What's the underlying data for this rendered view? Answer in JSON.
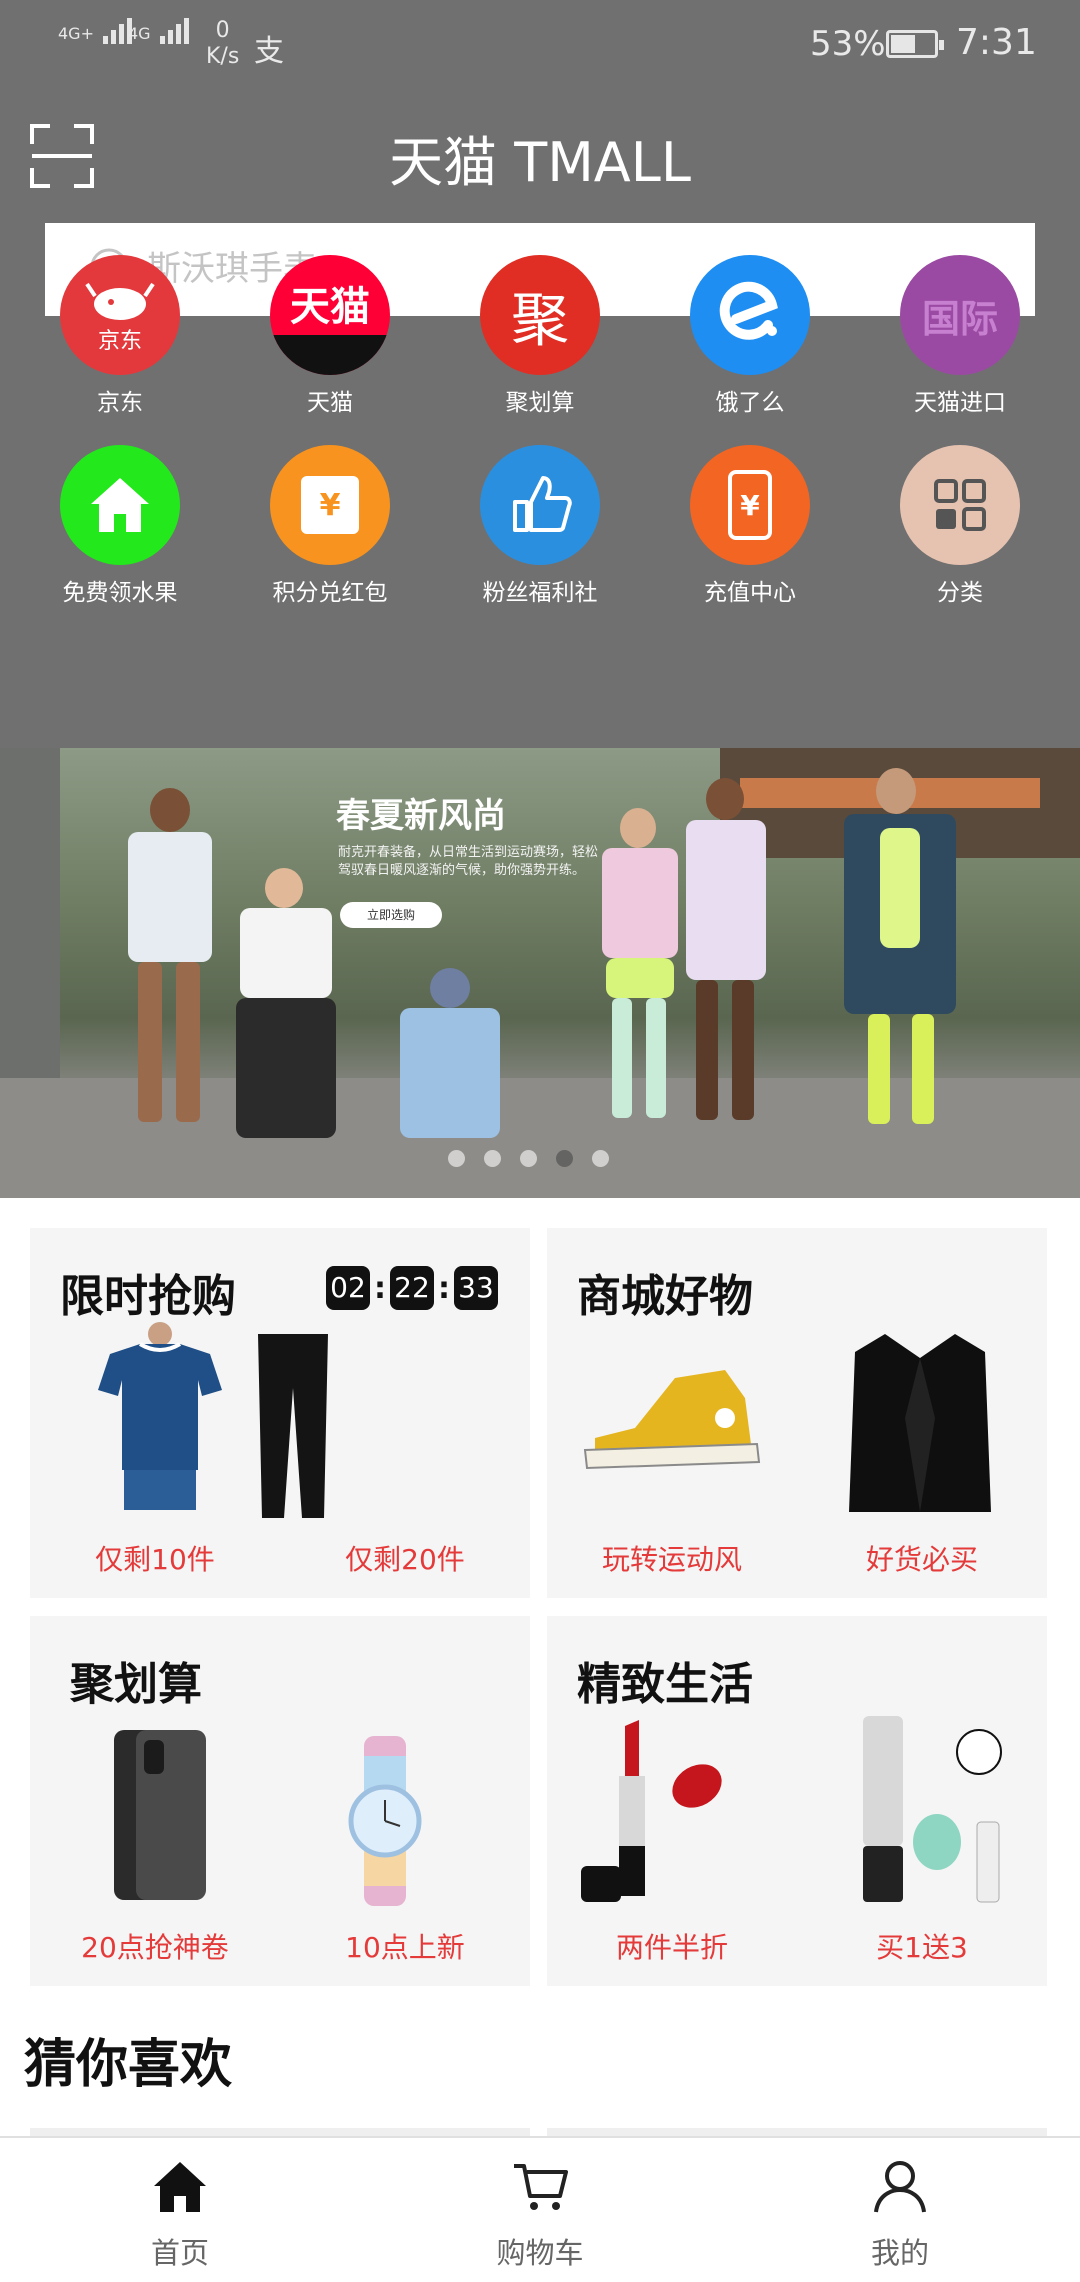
{
  "status_bar": {
    "sig1_label": "4G+",
    "sig2_label": "4G",
    "net_speed_value": "0",
    "net_speed_unit": "K/s",
    "alipay_glyph": "支",
    "battery_percent": "53%",
    "battery_level": 0.53,
    "time": "7:31"
  },
  "header": {
    "title": "天猫 TMALL",
    "scan_icon": "scan-icon",
    "search": {
      "placeholder": "斯沃琪手表",
      "icon": "search-icon"
    }
  },
  "categories": [
    {
      "label": "京东",
      "icon_text": "京东",
      "color": "#e4393c"
    },
    {
      "label": "天猫",
      "icon_text": "天猫",
      "color": "#ff0036"
    },
    {
      "label": "聚划算",
      "icon_text": "聚",
      "color": "#e02e24"
    },
    {
      "label": "饿了么",
      "icon_text": "e",
      "color": "#1e8ef3"
    },
    {
      "label": "天猫进口",
      "icon_text": "国际",
      "color": "#9b4aa3"
    },
    {
      "label": "免费领水果",
      "icon": "home-icon",
      "color": "#22e81c"
    },
    {
      "label": "积分兑红包",
      "icon_text": "¥",
      "color": "#f7931e"
    },
    {
      "label": "粉丝福利社",
      "icon": "thumbs-up-icon",
      "color": "#2b8fe0"
    },
    {
      "label": "充值中心",
      "icon_text": "¥",
      "color": "#f26522"
    },
    {
      "label": "分类",
      "icon": "grid-icon",
      "color": "#e6c2b0"
    }
  ],
  "banner": {
    "title": "春夏新风尚",
    "subtitle": "耐克开春装备，从日常生活到运动赛场，轻松驾驭春日暖风逐渐的气候，助你强势开练。",
    "button_label": "立即选购",
    "slide_count": 5,
    "active_slide": 3
  },
  "cards": [
    {
      "title": "限时抢购",
      "countdown": {
        "hours": "02",
        "minutes": "22",
        "seconds": "33",
        "separator": ":"
      },
      "items": [
        {
          "caption": "仅剩10件"
        },
        {
          "caption": "仅剩20件"
        }
      ]
    },
    {
      "title": "商城好物",
      "items": [
        {
          "caption": "玩转运动风"
        },
        {
          "caption": "好货必买"
        }
      ]
    },
    {
      "title": "聚划算",
      "items": [
        {
          "caption": "20点抢神卷"
        },
        {
          "caption": "10点上新"
        }
      ]
    },
    {
      "title": "精致生活",
      "items": [
        {
          "caption": "两件半折"
        },
        {
          "caption": "买1送3"
        }
      ]
    }
  ],
  "guess_title": "猜你喜欢",
  "tabs": [
    {
      "label": "首页",
      "icon": "home-icon",
      "active": true
    },
    {
      "label": "购物车",
      "icon": "cart-icon",
      "active": false
    },
    {
      "label": "我的",
      "icon": "user-icon",
      "active": false
    }
  ],
  "colors": {
    "header_bg": "#707070",
    "accent_red": "#e53a3a",
    "card_bg": "#f5f5f5"
  }
}
